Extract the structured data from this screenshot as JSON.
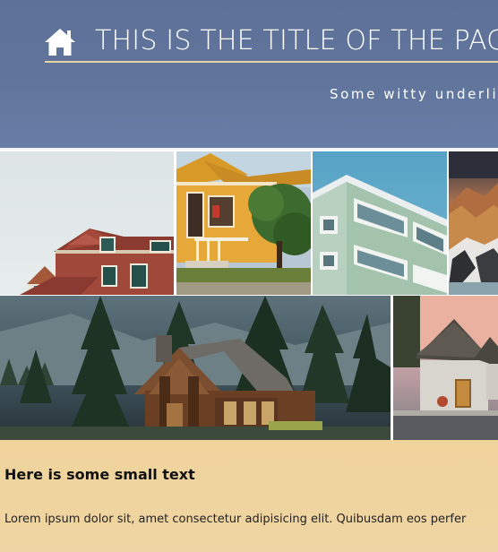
{
  "header": {
    "home_icon": "home-icon",
    "title": "THIS IS THE TITLE OF THE PAGE",
    "subtitle": "Some witty underli",
    "colors": {
      "background": "#61759c",
      "underline": "#e8d3a3",
      "text": "#ffffff"
    }
  },
  "gallery": {
    "images": [
      {
        "name": "victorian-house-photo"
      },
      {
        "name": "yellow-house-photo"
      },
      {
        "name": "green-apartment-photo"
      },
      {
        "name": "mountain-photo"
      },
      {
        "name": "forest-cabin-photo"
      },
      {
        "name": "thatched-huts-photo"
      }
    ]
  },
  "footer": {
    "heading": "Here is some small text",
    "body": "Lorem ipsum dolor sit, amet consectetur adipisicing elit. Quibusdam eos perfer",
    "background_color": "#f1d49c"
  }
}
